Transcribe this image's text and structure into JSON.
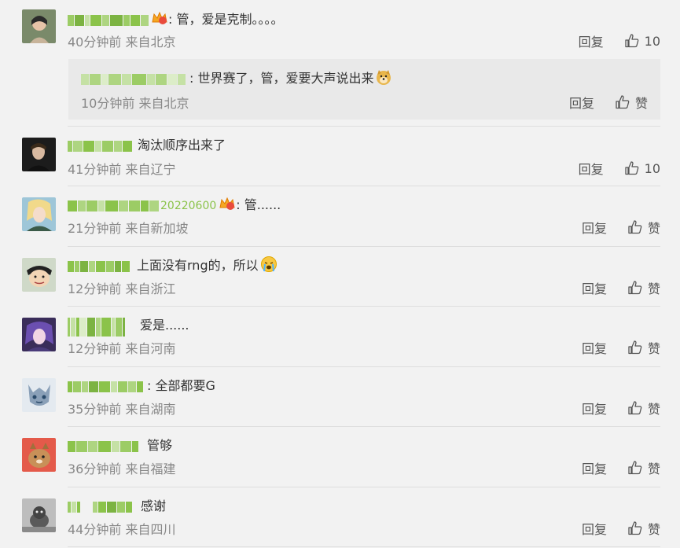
{
  "comments": [
    {
      "text": ": 管，爱是克制。。。。",
      "meta": "40分钟前 来自北京",
      "reply": "回复",
      "like": "10",
      "reply_comment": {
        "text": ": 世界赛了，管，爱要大声说出来",
        "meta": "10分钟前 来自北京",
        "reply": "回复",
        "like": "赞"
      }
    },
    {
      "text": "淘汰顺序出来了",
      "meta": "41分钟前 来自辽宁",
      "reply": "回复",
      "like": "10"
    },
    {
      "text": ": 管......",
      "username_tail": "20220600",
      "meta": "21分钟前 来自新加坡",
      "reply": "回复",
      "like": "赞"
    },
    {
      "text": "上面没有rng的，所以",
      "meta": "12分钟前 来自浙江",
      "reply": "回复",
      "like": "赞"
    },
    {
      "text": "爱是......",
      "meta": "12分钟前 来自河南",
      "reply": "回复",
      "like": "赞"
    },
    {
      "text": ": 全部都要G",
      "meta": "35分钟前 来自湖南",
      "reply": "回复",
      "like": "赞"
    },
    {
      "text": "管够",
      "meta": "36分钟前 来自福建",
      "reply": "回复",
      "like": "赞"
    },
    {
      "text": "感谢",
      "meta": "44分钟前 来自四川",
      "reply": "回复",
      "like": "赞"
    }
  ],
  "colors": {
    "username_blur": "#8bc34a",
    "separator": "#dedede",
    "nested_bg": "#e9e9e9"
  },
  "icons": {
    "like": "thumbs-up-icon",
    "badge": "crown-badge-icon",
    "doge": "doge-emoji-icon",
    "cry": "crying-emoji-icon"
  }
}
